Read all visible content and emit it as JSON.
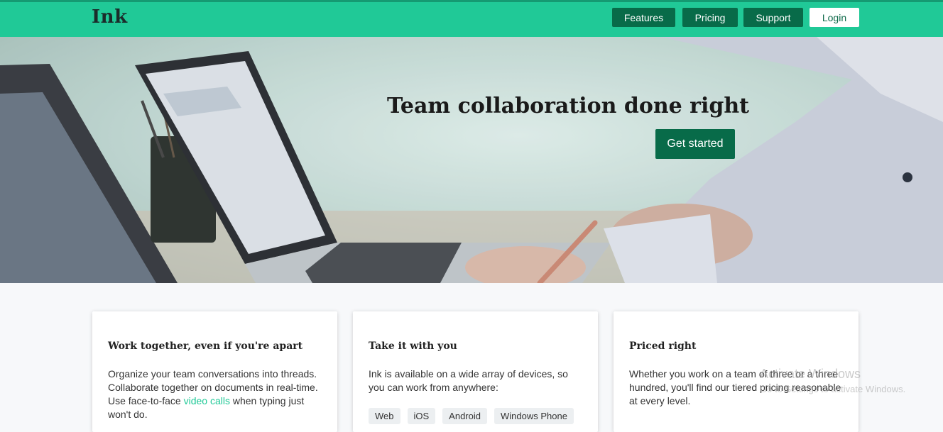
{
  "header": {
    "logo": "Ink",
    "nav": [
      "Features",
      "Pricing",
      "Support"
    ],
    "login": "Login"
  },
  "hero": {
    "title": "Team collaboration done right",
    "cta": "Get started"
  },
  "cards": [
    {
      "title": "Work together, even if you're apart",
      "text_before": "Organize your team conversations into threads. Collaborate together on documents in real-time. Use face-to-face ",
      "link": "video calls",
      "text_after": " when typing just won't do."
    },
    {
      "title": "Take it with you",
      "text": "Ink is available on a wide array of devices, so you can work from anywhere:",
      "tags": [
        "Web",
        "iOS",
        "Android",
        "Windows Phone"
      ]
    },
    {
      "title": "Priced right",
      "text": "Whether you work on a team of three or a three hundred, you'll find our tiered pricing reasonable at every level."
    }
  ],
  "watermark": {
    "line1": "Activate Windows",
    "line2": "Go to Settings to activate Windows."
  },
  "colors": {
    "header_bg": "#20c997",
    "nav_button_bg": "#086b49",
    "link": "#20c997"
  }
}
